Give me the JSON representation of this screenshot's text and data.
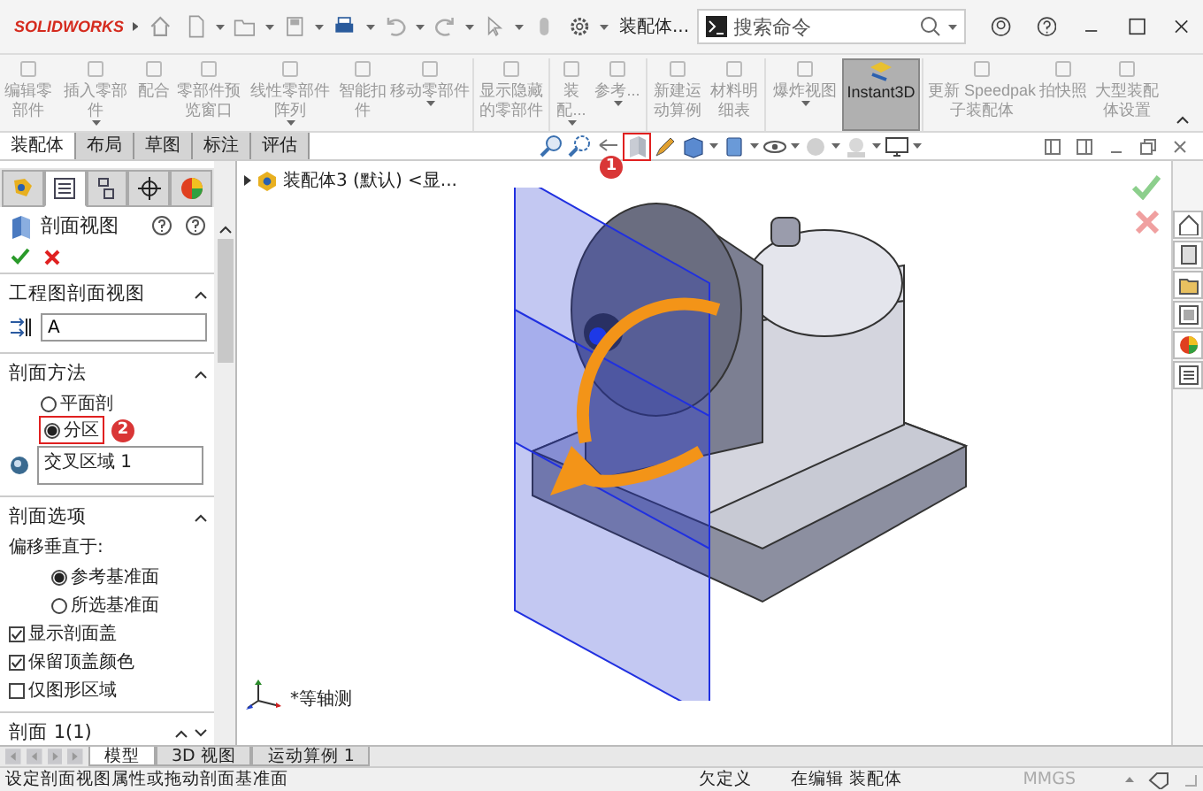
{
  "title_bar": {
    "app": "SOLIDWORKS",
    "document": "装配体...",
    "search": {
      "placeholder": "搜索命令"
    }
  },
  "ribbon": [
    {
      "label": "编辑零部件",
      "selected": false,
      "menu": false
    },
    {
      "label": "插入零部件",
      "selected": false,
      "menu": true
    },
    {
      "label": "配合",
      "selected": false,
      "menu": false
    },
    {
      "label": "零部件预览窗口",
      "selected": false,
      "menu": false
    },
    {
      "label": "线性零部件阵列",
      "selected": false,
      "menu": true
    },
    {
      "label": "智能扣件",
      "selected": false,
      "menu": false
    },
    {
      "label": "移动零部件",
      "selected": false,
      "menu": true
    },
    {
      "label": "显示隐藏的零部件",
      "selected": false,
      "menu": false
    },
    {
      "label": "装配...",
      "selected": false,
      "menu": true
    },
    {
      "label": "参考...",
      "selected": false,
      "menu": true
    },
    {
      "label": "新建运动算例",
      "selected": false,
      "menu": false
    },
    {
      "label": "材料明细表",
      "selected": false,
      "menu": false
    },
    {
      "label": "爆炸视图",
      "selected": false,
      "menu": true
    },
    {
      "label": "Instant3D",
      "selected": true,
      "menu": false
    },
    {
      "label": "更新 Speedpak 子装配体",
      "selected": false,
      "menu": false
    },
    {
      "label": "拍快照",
      "selected": false,
      "menu": false
    },
    {
      "label": "大型装配体设置",
      "selected": false,
      "menu": false
    }
  ],
  "tabs": [
    {
      "label": "装配体",
      "selected": true
    },
    {
      "label": "布局",
      "selected": false
    },
    {
      "label": "草图",
      "selected": false
    },
    {
      "label": "标注",
      "selected": false
    },
    {
      "label": "评估",
      "selected": false
    }
  ],
  "view_toolbar": [
    {
      "kind": "zoom-fit",
      "highlighted": false
    },
    {
      "kind": "zoom-area",
      "highlighted": false
    },
    {
      "kind": "previous",
      "highlighted": false
    },
    {
      "kind": "section",
      "highlighted": true,
      "badge": "1"
    },
    {
      "kind": "pencil",
      "highlighted": false
    },
    {
      "kind": "cube",
      "highlighted": false
    },
    {
      "kind": "box",
      "highlighted": false
    },
    {
      "kind": "eye",
      "highlighted": false
    },
    {
      "kind": "sphere",
      "highlighted": false
    },
    {
      "kind": "scene",
      "highlighted": false
    },
    {
      "kind": "monitor",
      "highlighted": false
    }
  ],
  "panel_tabs": [
    {
      "selected": false
    },
    {
      "selected": true
    },
    {
      "selected": false
    },
    {
      "selected": false
    },
    {
      "selected": false
    }
  ],
  "property_manager": {
    "title": "剖面视图",
    "sections": [
      {
        "kind": "field",
        "title": "工程图剖面视图",
        "expanded": true,
        "value": "A"
      },
      {
        "kind": "method",
        "title": "剖面方法",
        "expanded": true,
        "options": [
          {
            "label": "平面剖",
            "selected": false
          },
          {
            "label": "分区",
            "selected": true,
            "badge": "2"
          }
        ],
        "value": "交叉区域 1"
      },
      {
        "kind": "options",
        "title": "剖面选项",
        "expanded": true,
        "caption": "偏移垂直于:",
        "options": [
          {
            "label": "参考基准面",
            "selected": true
          },
          {
            "label": "所选基准面",
            "selected": false
          }
        ],
        "checks": [
          {
            "label": "显示剖面盖",
            "checked": true
          },
          {
            "label": "保留顶盖颜色",
            "checked": true
          },
          {
            "label": "仅图形区域",
            "checked": false
          }
        ]
      },
      {
        "kind": "collapsed",
        "title": "剖面 1(1)",
        "expanded": false
      }
    ]
  },
  "tree": {
    "label": "装配体3 (默认) <显..."
  },
  "view_label": "*等轴测",
  "bottom_tabs": [
    {
      "label": "模型",
      "selected": true
    },
    {
      "label": "3D 视图",
      "selected": false
    },
    {
      "label": "运动算例 1",
      "selected": false
    }
  ],
  "status_bar": {
    "message": "设定剖面视图属性或拖动剖面基准面",
    "state": "欠定义",
    "mode": "在编辑 装配体",
    "units": "MMGS"
  }
}
